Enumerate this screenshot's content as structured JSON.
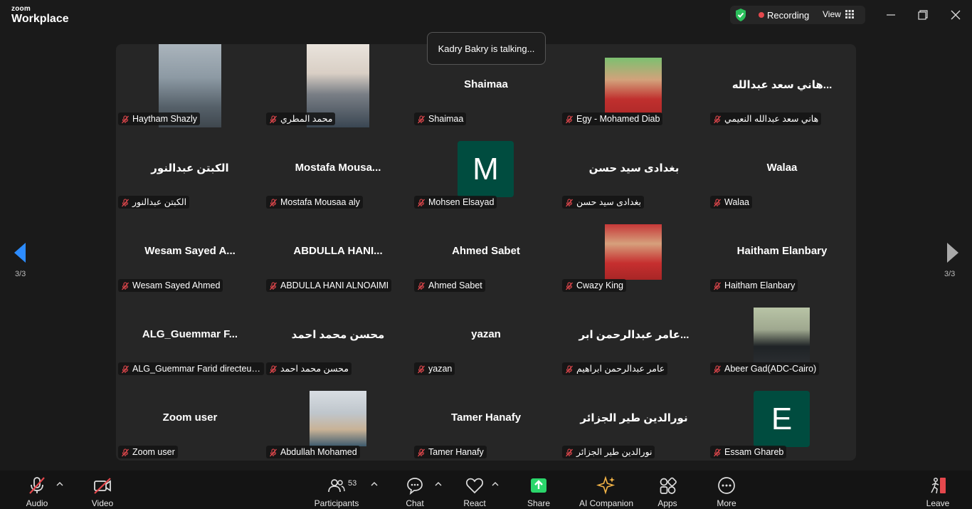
{
  "app": {
    "logo_top": "zoom",
    "logo_bottom": "Workplace"
  },
  "titlebar": {
    "recording_label": "Recording",
    "view_label": "View",
    "icons": [
      "shield-check-icon",
      "grid-icon",
      "minimize-icon",
      "restore-icon",
      "close-icon"
    ]
  },
  "toast": {
    "text": "Kadry Bakry is talking..."
  },
  "pagination": {
    "left_page": "3/3",
    "right_page": "3/3"
  },
  "tiles": [
    {
      "display": "",
      "label": "Haytham Shazly",
      "type": "video"
    },
    {
      "display": "",
      "label": "محمد المطري",
      "type": "video"
    },
    {
      "display": "Shaimaa",
      "label": "Shaimaa",
      "type": "name"
    },
    {
      "display": "",
      "label": "Egy - Mohamed Diab",
      "type": "photo"
    },
    {
      "display": "هاني سعد عبدالله...",
      "label": "هاني سعد عبدالله النعيمي",
      "type": "name"
    },
    {
      "display": "الكبتن عبدالنور",
      "label": "الكبتن عبدالنور",
      "type": "name"
    },
    {
      "display": "Mostafa  Mousa...",
      "label": "Mostafa Mousaa aly",
      "type": "name"
    },
    {
      "display": "M",
      "label": "Mohsen Elsayad",
      "type": "letter"
    },
    {
      "display": "بغدادى سيد حسن",
      "label": "بغدادى سيد حسن",
      "type": "name"
    },
    {
      "display": "Walaa",
      "label": "Walaa",
      "type": "name"
    },
    {
      "display": "Wesam  Sayed  A...",
      "label": "Wesam Sayed Ahmed",
      "type": "name"
    },
    {
      "display": "ABDULLA  HANI...",
      "label": "ABDULLA HANI ALNOAIMI",
      "type": "name"
    },
    {
      "display": "Ahmed Sabet",
      "label": "Ahmed Sabet",
      "type": "name"
    },
    {
      "display": "",
      "label": "Cwazy King",
      "type": "photo"
    },
    {
      "display": "Haitham Elanbary",
      "label": "Haitham Elanbary",
      "type": "name"
    },
    {
      "display": "ALG_Guemmar F...",
      "label": "ALG_Guemmar Farid directeur...",
      "type": "name"
    },
    {
      "display": "محسن محمد احمد",
      "label": "محسن محمد احمد",
      "type": "name"
    },
    {
      "display": "yazan",
      "label": "yazan",
      "type": "name"
    },
    {
      "display": "عامر عبدالرحمن ابر...",
      "label": "عامر عبدالرحمن ابراهيم",
      "type": "name"
    },
    {
      "display": "",
      "label": "Abeer Gad(ADC-Cairo)",
      "type": "photo"
    },
    {
      "display": "Zoom user",
      "label": "Zoom user",
      "type": "name"
    },
    {
      "display": "",
      "label": "Abdullah Mohamed",
      "type": "photo"
    },
    {
      "display": "Tamer Hanafy",
      "label": "Tamer Hanafy",
      "type": "name"
    },
    {
      "display": "نورالدين طير الجزائر",
      "label": "نورالدين طير الجزائر",
      "type": "name"
    },
    {
      "display": "E",
      "label": "Essam Ghareb",
      "type": "letter"
    }
  ],
  "toolbar": {
    "audio": "Audio",
    "video": "Video",
    "participants": "Participants",
    "participants_count": "53",
    "chat": "Chat",
    "react": "React",
    "share": "Share",
    "ai_companion": "AI Companion",
    "apps": "Apps",
    "more": "More",
    "leave": "Leave"
  },
  "colors": {
    "recording": "#e5484d",
    "shield": "#2bbf5b",
    "share": "#2bd66b",
    "avatar": "#004c3f",
    "leave": "#e5484d",
    "muted": "#e5484d",
    "ai": "#f5b547"
  }
}
